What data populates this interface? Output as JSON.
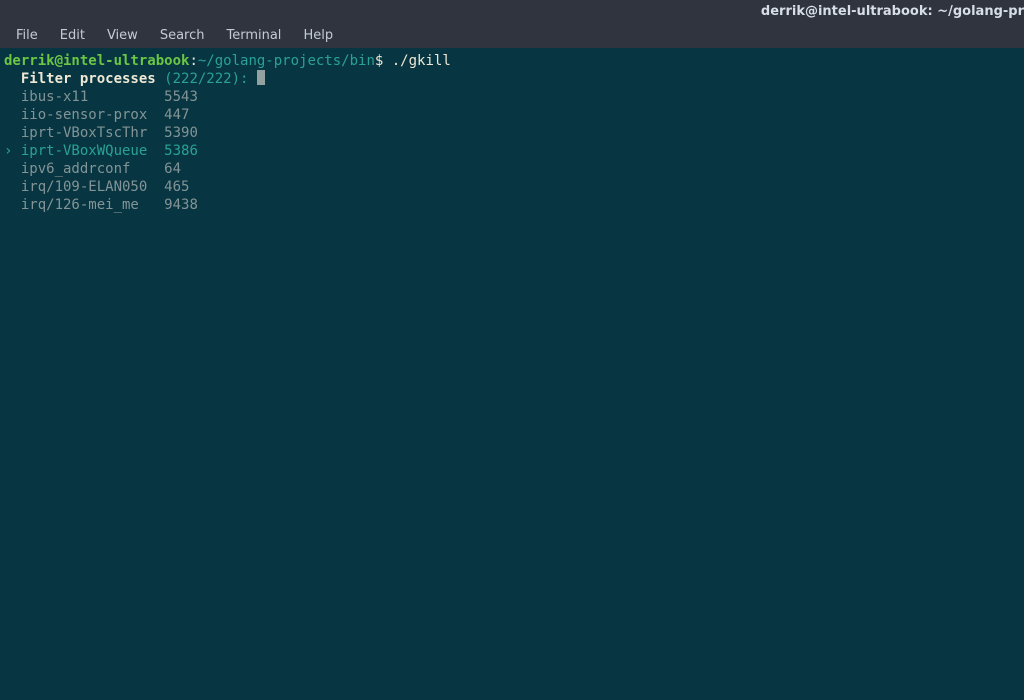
{
  "window": {
    "title": "derrik@intel-ultrabook: ~/golang-pr"
  },
  "menubar": {
    "items": [
      "File",
      "Edit",
      "View",
      "Search",
      "Terminal",
      "Help"
    ]
  },
  "prompt": {
    "user_host": "derrik@intel-ultrabook",
    "sep": ":",
    "path": "~/golang-projects/bin",
    "sigil": "$",
    "command": "./gkill"
  },
  "filter": {
    "label": "Filter processes",
    "count": "(222/222):"
  },
  "selected_index": 3,
  "caret": "›",
  "processes": [
    {
      "name": "ibus-x11",
      "pid": "5543"
    },
    {
      "name": "iio-sensor-prox",
      "pid": "447"
    },
    {
      "name": "iprt-VBoxTscThr",
      "pid": "5390"
    },
    {
      "name": "iprt-VBoxWQueue",
      "pid": "5386"
    },
    {
      "name": "ipv6_addrconf",
      "pid": "64"
    },
    {
      "name": "irq/109-ELAN050",
      "pid": "465"
    },
    {
      "name": "irq/126-mei_me",
      "pid": "9438"
    }
  ]
}
